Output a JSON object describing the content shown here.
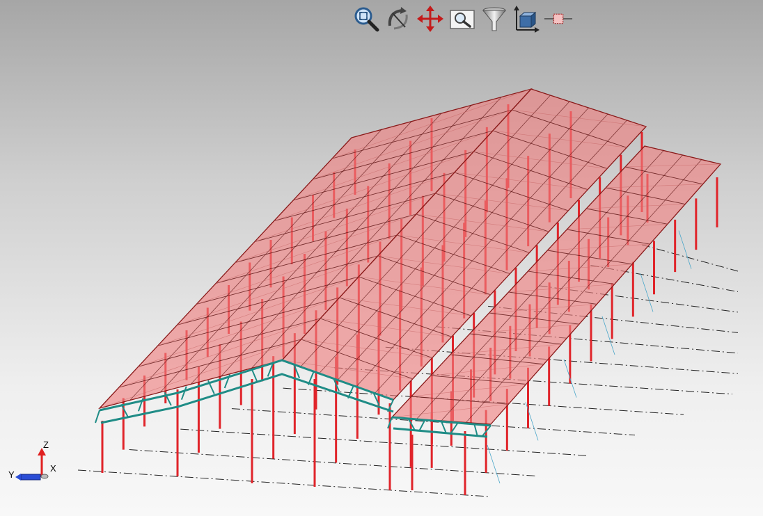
{
  "toolbar": {
    "tools": [
      {
        "name": "zoom-extents",
        "icon": "zoom-extents-icon"
      },
      {
        "name": "rotate",
        "icon": "rotate-icon"
      },
      {
        "name": "pan",
        "icon": "pan-icon"
      },
      {
        "name": "zoom-window",
        "icon": "zoom-window-icon"
      },
      {
        "name": "filter",
        "icon": "filter-icon"
      },
      {
        "name": "view-axes",
        "icon": "view-axes-icon"
      },
      {
        "name": "node-display",
        "icon": "node-display-icon"
      }
    ]
  },
  "axis_triad": {
    "z_label": "Z",
    "x_label": "X",
    "y_label": "Y"
  },
  "colors": {
    "roof_fill": "#f08080",
    "roof_edge": "#8a1a1a",
    "column": "#e0242a",
    "truss": "#1f8c86",
    "gridline": "#222222"
  }
}
